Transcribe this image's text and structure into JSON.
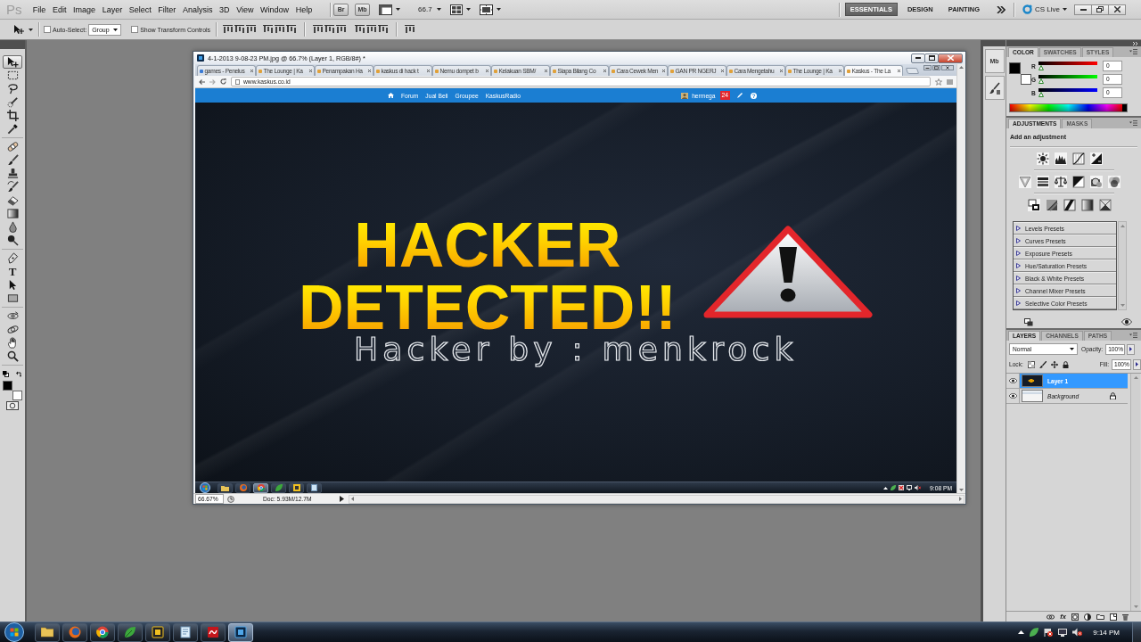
{
  "app_bar": {
    "logo": "Ps",
    "menus": [
      "File",
      "Edit",
      "Image",
      "Layer",
      "Select",
      "Filter",
      "Analysis",
      "3D",
      "View",
      "Window",
      "Help"
    ],
    "bridge": "Br",
    "mini_bridge": "Mb",
    "zoom": "66.7",
    "workspaces": [
      {
        "label": "ESSENTIALS",
        "selected": true
      },
      {
        "label": "DESIGN",
        "selected": false
      },
      {
        "label": "PAINTING",
        "selected": false
      }
    ],
    "cs_live": "CS Live"
  },
  "options_bar": {
    "auto_select": {
      "label": "Auto-Select:",
      "checked": false
    },
    "auto_select_target": "Group",
    "transform_controls": {
      "label": "Show Transform Controls",
      "checked": false
    }
  },
  "tools": [
    {
      "selected": true
    },
    {
      "selected": false
    },
    {
      "selected": false
    },
    {
      "selected": false
    },
    {
      "selected": false
    },
    {
      "selected": false
    },
    {
      "selected": false
    },
    {
      "selected": false
    },
    {
      "selected": false
    },
    {
      "selected": false
    },
    {
      "selected": false
    },
    {
      "selected": false
    },
    {
      "selected": false
    },
    {
      "selected": false
    },
    {
      "selected": false
    },
    {
      "selected": false,
      "label": "T"
    },
    {
      "selected": false
    },
    {
      "selected": false
    },
    {
      "selected": false
    },
    {
      "selected": false
    },
    {
      "selected": false
    },
    {
      "selected": false
    }
  ],
  "tool_colors": [
    {
      "kind": "foreground",
      "color": "#000000"
    },
    {
      "kind": "background",
      "color": "#ffffff"
    }
  ],
  "document": {
    "title": "4-1-2013 9-08-23 PM.jpg @ 66.7% (Layer 1, RGB/8#) *",
    "zoom": "66.67%",
    "doc_size": "Doc: 5.93M/12.7M",
    "browser": {
      "tabs": [
        {
          "label": "games - Penelus",
          "selected": false
        },
        {
          "label": "The Lounge | Ka",
          "selected": false
        },
        {
          "label": "Penampakan Ha",
          "selected": false
        },
        {
          "label": "kaskus di hack t",
          "selected": false
        },
        {
          "label": "Nemu dompet b",
          "selected": false
        },
        {
          "label": "Kelakuan SBM/",
          "selected": false
        },
        {
          "label": "Siapa Bilang Co",
          "selected": false
        },
        {
          "label": "Cara Cewek Men",
          "selected": false
        },
        {
          "label": "GAN PR NGERJ",
          "selected": false
        },
        {
          "label": "Cara Mengetahu",
          "selected": false
        },
        {
          "label": "The Lounge | Ka",
          "selected": false
        },
        {
          "label": "Kaskus - The La",
          "selected": true
        }
      ],
      "url": "www.kaskus.co.id",
      "nav": [
        "Forum",
        "Jual Beli",
        "Groupee",
        "KaskusRadio"
      ],
      "user": "hermega",
      "notifications": "24"
    },
    "banner": {
      "headline": [
        "HACKER",
        "DETECTED!!"
      ],
      "credit": "Hacker by : menkrock"
    },
    "taskbar_time": "9:08 PM"
  },
  "dock": {
    "mini_bridge": "Mb"
  },
  "color_panel": {
    "tabs": [
      {
        "label": "COLOR",
        "selected": true
      },
      {
        "label": "SWATCHES",
        "selected": false
      },
      {
        "label": "STYLES",
        "selected": false
      }
    ],
    "swatches": [
      {
        "kind": "foreground",
        "color": "#000000"
      },
      {
        "kind": "background",
        "color": "#ffffff"
      }
    ],
    "channels": [
      {
        "label": "R",
        "level": 0,
        "value": "0"
      },
      {
        "label": "G",
        "level": 0,
        "value": "0"
      },
      {
        "label": "B",
        "level": 0,
        "value": "0"
      }
    ]
  },
  "adjustments_panel": {
    "tabs": [
      {
        "label": "ADJUSTMENTS",
        "selected": true
      },
      {
        "label": "MASKS",
        "selected": false
      }
    ],
    "heading": "Add an adjustment",
    "presets": [
      {
        "label": "Levels Presets",
        "expanded": false
      },
      {
        "label": "Curves Presets",
        "expanded": false
      },
      {
        "label": "Exposure Presets",
        "expanded": false
      },
      {
        "label": "Hue/Saturation Presets",
        "expanded": false
      },
      {
        "label": "Black & White Presets",
        "expanded": false
      },
      {
        "label": "Channel Mixer Presets",
        "expanded": false
      },
      {
        "label": "Selective Color Presets",
        "expanded": false
      }
    ]
  },
  "layers_panel": {
    "tabs": [
      {
        "label": "LAYERS",
        "selected": true
      },
      {
        "label": "CHANNELS",
        "selected": false
      },
      {
        "label": "PATHS",
        "selected": false
      }
    ],
    "blend_mode": "Normal",
    "opacity_label": "Opacity:",
    "opacity": "100%",
    "lock_label": "Lock:",
    "fill_label": "Fill:",
    "fill": "100%",
    "layers": [
      {
        "name": "Layer 1",
        "kind": "layer",
        "selected": true,
        "visible": true,
        "locked": false
      },
      {
        "name": "Background",
        "kind": "background",
        "selected": false,
        "visible": true,
        "locked": true
      }
    ],
    "effects_label": "fx"
  },
  "taskbar": {
    "apps": [
      {
        "active": false
      },
      {
        "active": false
      },
      {
        "active": false
      },
      {
        "active": false
      },
      {
        "active": false
      },
      {
        "active": false
      },
      {
        "active": false
      },
      {
        "active": true
      }
    ],
    "time": "9:14 PM"
  }
}
